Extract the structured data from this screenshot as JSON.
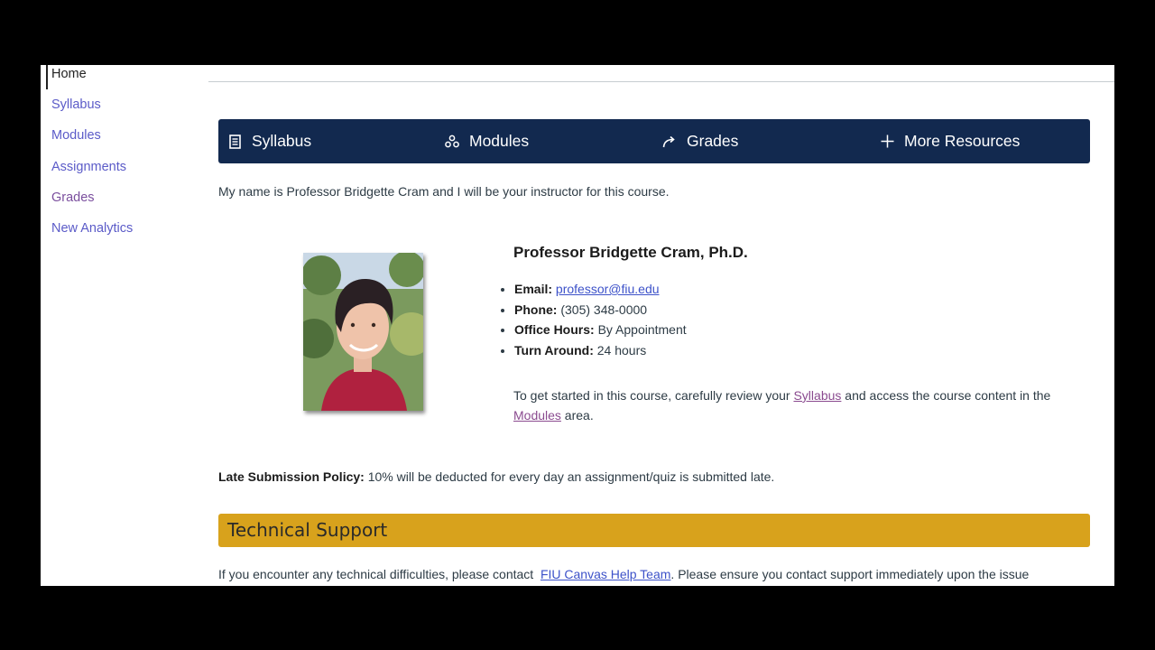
{
  "course_nav": {
    "items": [
      {
        "label": "Home",
        "state": "active"
      },
      {
        "label": "Syllabus",
        "state": "link"
      },
      {
        "label": "Modules",
        "state": "link"
      },
      {
        "label": "Assignments",
        "state": "link"
      },
      {
        "label": "Grades",
        "state": "visited"
      },
      {
        "label": "New Analytics",
        "state": "link"
      }
    ]
  },
  "button_bar": {
    "syllabus": {
      "label": "Syllabus",
      "icon": "syllabus-document-icon"
    },
    "modules": {
      "label": "Modules",
      "icon": "modules-icon"
    },
    "grades": {
      "label": "Grades",
      "icon": "grades-arrow-icon"
    },
    "more": {
      "label": "More Resources",
      "icon": "plus-icon"
    }
  },
  "intro": "My name is Professor Bridgette Cram and I will be your instructor for this course.",
  "instructor": {
    "name": "Professor Bridgette Cram, Ph.D.",
    "email_label": "Email:",
    "email": "professor@fiu.edu",
    "phone_label": "Phone:",
    "phone": "(305) 348-0000",
    "office_label": "Office Hours:",
    "office": "By Appointment",
    "turnaround_label": "Turn Around:",
    "turnaround": "24 hours"
  },
  "get_started": {
    "part1": "To get started in this course, carefully review your ",
    "syllabus_link": "Syllabus",
    "part2": " and access the course content in the",
    "modules_link": "Modules",
    "part3": " area."
  },
  "late_policy": {
    "label": "Late Submission Policy:",
    "text": " 10% will be deducted for every day an assignment/quiz is submitted late."
  },
  "tech_support": {
    "title": "Technical Support",
    "part1": "If you encounter any technical difficulties, please contact  ",
    "link": "FIU Canvas Help Team",
    "part2": ". Please ensure you contact support immediately upon the issue"
  },
  "colors": {
    "nav_bar": "#12294f",
    "support_banner": "#d8a21c",
    "link": "#3d52c9",
    "visited_link": "#8a4a8f"
  }
}
